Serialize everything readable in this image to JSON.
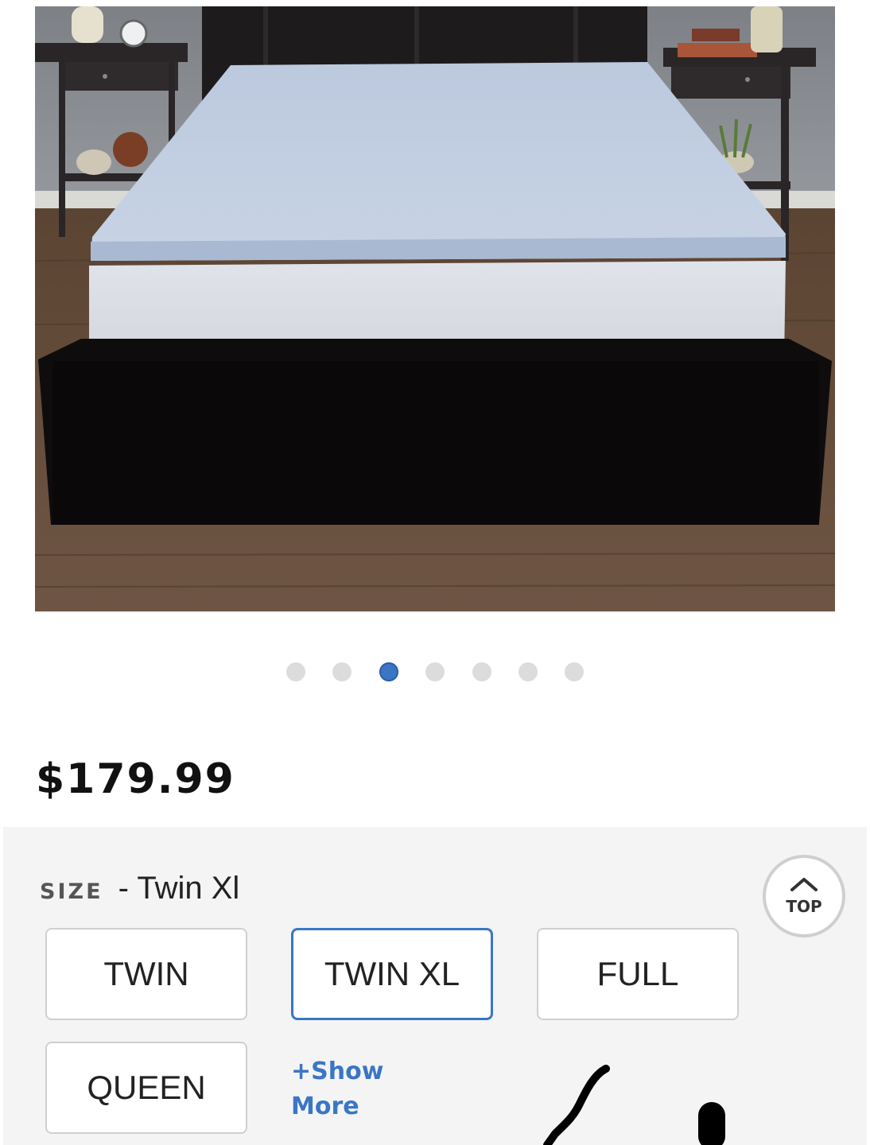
{
  "product": {
    "image_alt": "Gel memory foam mattress topper on dark bed frame",
    "carousel": {
      "count": 7,
      "active_index": 2
    },
    "price": "$179.99"
  },
  "size_selector": {
    "label": "SIZE",
    "separator": " - ",
    "selected_value": "Twin Xl",
    "options": [
      "TWIN",
      "TWIN XL",
      "FULL",
      "QUEEN"
    ],
    "show_more": "+Show More"
  },
  "back_to_top": {
    "label": "TOP"
  },
  "colors": {
    "accent": "#3a76c4",
    "panel_bg": "#f4f4f4",
    "border": "#cfcfcf"
  }
}
